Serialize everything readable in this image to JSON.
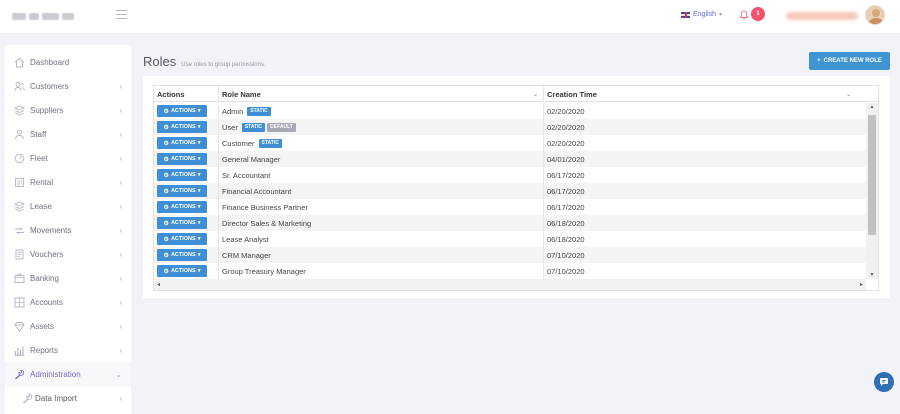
{
  "header": {
    "language": "English",
    "notification_count": "1"
  },
  "sidebar": {
    "items": [
      {
        "label": "Dashboard",
        "icon": "home-icon",
        "has_chevron": false
      },
      {
        "label": "Customers",
        "icon": "customers-icon",
        "has_chevron": true
      },
      {
        "label": "Suppliers",
        "icon": "suppliers-icon",
        "has_chevron": true
      },
      {
        "label": "Staff",
        "icon": "staff-icon",
        "has_chevron": true
      },
      {
        "label": "Fleet",
        "icon": "fleet-icon",
        "has_chevron": true
      },
      {
        "label": "Rental",
        "icon": "rental-icon",
        "has_chevron": true
      },
      {
        "label": "Lease",
        "icon": "lease-icon",
        "has_chevron": true
      },
      {
        "label": "Movements",
        "icon": "movements-icon",
        "has_chevron": true
      },
      {
        "label": "Vouchers",
        "icon": "vouchers-icon",
        "has_chevron": true
      },
      {
        "label": "Banking",
        "icon": "banking-icon",
        "has_chevron": true
      },
      {
        "label": "Accounts",
        "icon": "accounts-icon",
        "has_chevron": true
      },
      {
        "label": "Assets",
        "icon": "assets-icon",
        "has_chevron": true
      },
      {
        "label": "Reports",
        "icon": "reports-icon",
        "has_chevron": true
      },
      {
        "label": "Administration",
        "icon": "wrench-icon",
        "has_chevron": true,
        "active": true,
        "expanded": true
      },
      {
        "label": "Data Import",
        "icon": "wrench-icon",
        "has_chevron": true,
        "sub": true
      }
    ]
  },
  "page": {
    "title": "Roles",
    "subtitle": "Use roles to group permissions.",
    "create_button": "CREATE NEW ROLE"
  },
  "table": {
    "columns": [
      "Actions",
      "Role Name",
      "Creation Time"
    ],
    "action_label": "ACTIONS",
    "tag_static": "STATIC",
    "tag_default": "DEFAULT",
    "rows": [
      {
        "name": "Admin",
        "static": true,
        "default": false,
        "created": "02/20/2020"
      },
      {
        "name": "User",
        "static": true,
        "default": true,
        "created": "02/20/2020"
      },
      {
        "name": "Customer",
        "static": true,
        "default": false,
        "created": "02/20/2020"
      },
      {
        "name": "General Manager",
        "static": false,
        "default": false,
        "created": "04/01/2020"
      },
      {
        "name": "Sr. Accountant",
        "static": false,
        "default": false,
        "created": "06/17/2020"
      },
      {
        "name": "Financial Accountant",
        "static": false,
        "default": false,
        "created": "06/17/2020"
      },
      {
        "name": "Finance Business Partner",
        "static": false,
        "default": false,
        "created": "06/17/2020"
      },
      {
        "name": "Director Sales & Marketing",
        "static": false,
        "default": false,
        "created": "06/18/2020"
      },
      {
        "name": "Lease Analyst",
        "static": false,
        "default": false,
        "created": "06/18/2020"
      },
      {
        "name": "CRM Manager",
        "static": false,
        "default": false,
        "created": "07/10/2020"
      },
      {
        "name": "Group Treasury Manager",
        "static": false,
        "default": false,
        "created": "07/10/2020"
      }
    ]
  },
  "colors": {
    "primary": "#3f8fd6",
    "badge": "#f4516c",
    "active_nav": "#716aca"
  }
}
